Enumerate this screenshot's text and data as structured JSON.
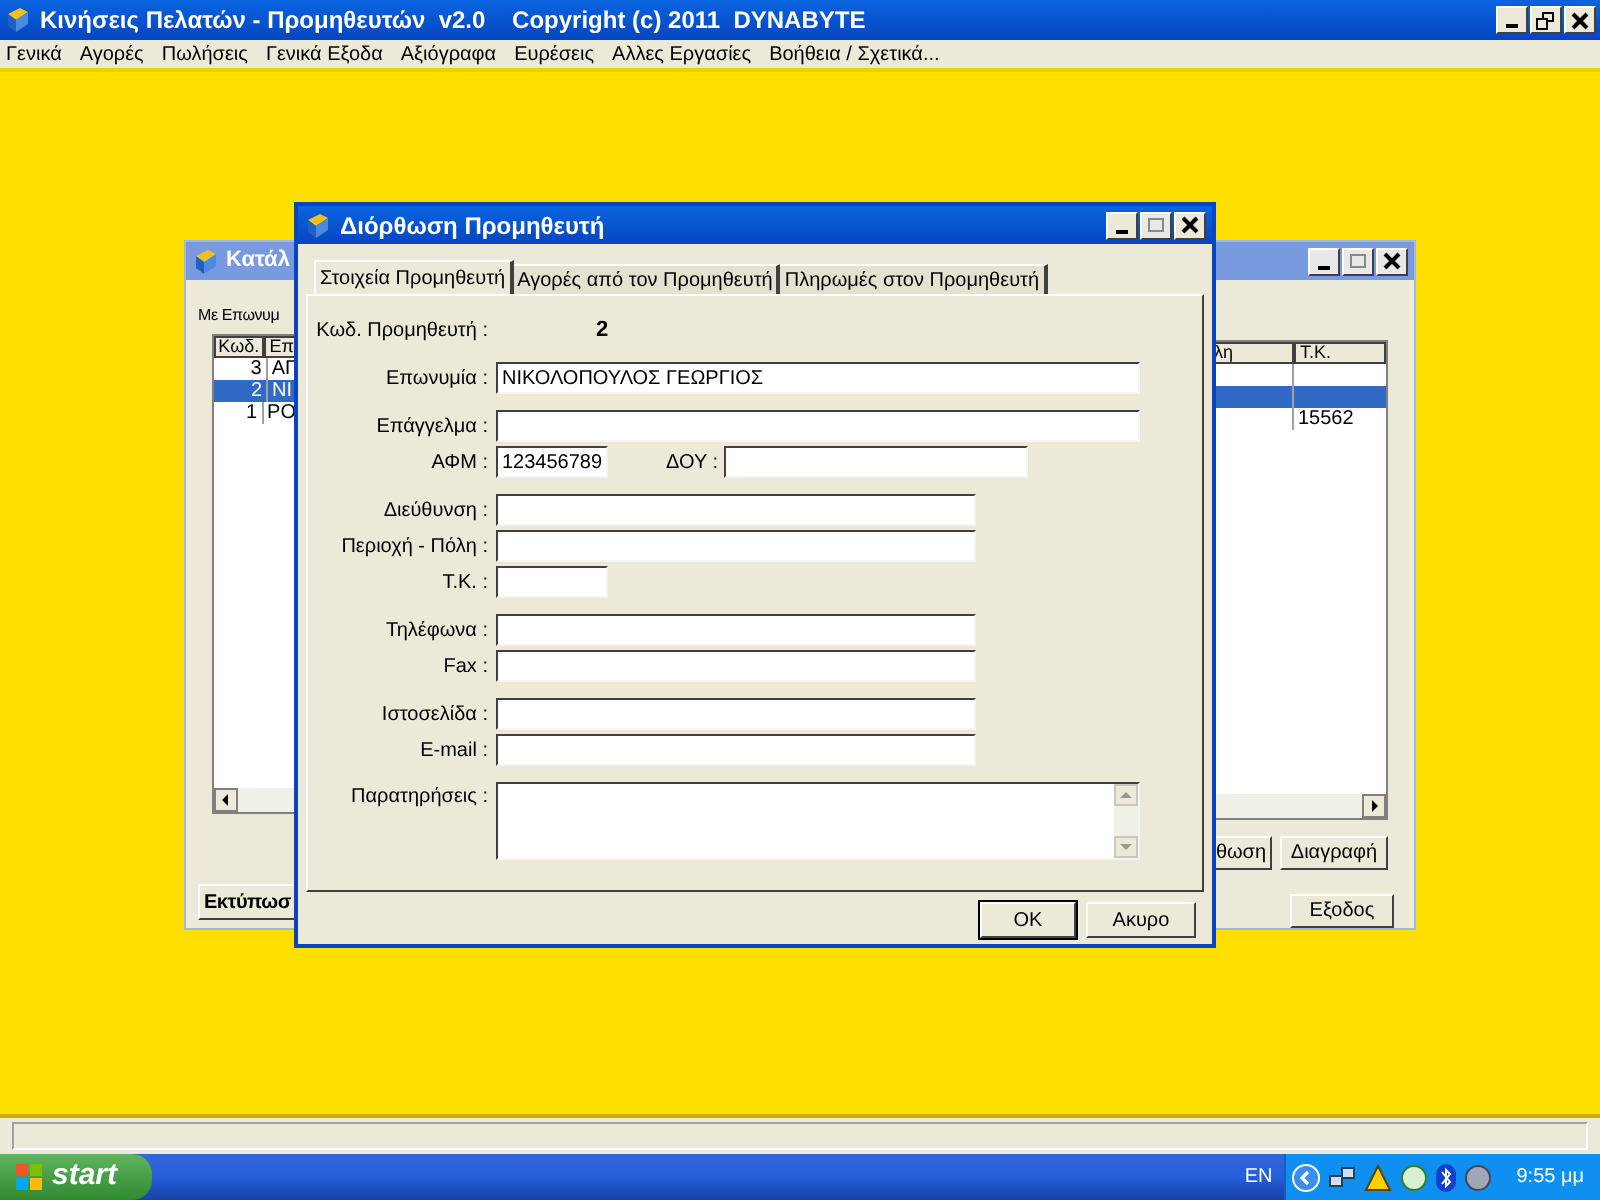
{
  "app": {
    "title": "Κινήσεις Πελατών - Προμηθευτών  v2.0    Copyright (c) 2011  DYNABYTE",
    "menu": [
      "Γενικά",
      "Αγορές",
      "Πωλήσεις",
      "Γενικά Εξοδα",
      "Αξιόγραφα",
      "Ευρέσεις",
      "Αλλες Εργασίες",
      "Βοήθεια / Σχετικά..."
    ]
  },
  "back_window": {
    "title": "Κατάλ",
    "filter_label": "Με Επωνυμ",
    "columns_left": [
      "Κωδ.",
      "Επ"
    ],
    "columns_right": [
      "λη",
      "Τ.Κ."
    ],
    "rows": [
      {
        "code": "3",
        "name": "ΑΓ",
        "selected": false
      },
      {
        "code": "2",
        "name": "ΝΙ",
        "selected": true
      },
      {
        "code": "1",
        "name": "ΡΟ",
        "tk": "15562",
        "selected": false
      }
    ],
    "buttons": [
      "θωση",
      "Διαγραφή"
    ],
    "print_button": "Εκτύπωσ",
    "exit_button": "Εξοδος"
  },
  "dialog": {
    "title": "Διόρθωση Προμηθευτή",
    "tabs": [
      {
        "label": "Στοιχεία Προμηθευτή",
        "selected": true
      },
      {
        "label": "Αγορές από τον Προμηθευτή",
        "selected": false
      },
      {
        "label": "Πληρωμές στον Προμηθευτή",
        "selected": false
      }
    ],
    "groups": [
      [
        {
          "kind": "value",
          "label": "Κωδ. Προμηθευτή :",
          "value": "2"
        }
      ],
      [
        {
          "kind": "input",
          "fields": [
            {
              "label": "Επωνυμία :",
              "value": "ΝΙΚΟΛΟΠΟΥΛΟΣ ΓΕΩΡΓΙΟΣ"
            }
          ]
        }
      ],
      [
        {
          "kind": "input",
          "fields": [
            {
              "label": "Επάγγελμα :"
            }
          ]
        },
        {
          "kind": "input",
          "fields": [
            {
              "label": "ΑΦΜ :",
              "value": "123456789"
            },
            {
              "label": "ΔΟΥ :"
            }
          ]
        }
      ],
      [
        {
          "kind": "input",
          "fields": [
            {
              "label": "Διεύθυνση :"
            }
          ]
        },
        {
          "kind": "input",
          "fields": [
            {
              "label": "Περιοχή - Πόλη :"
            }
          ]
        },
        {
          "kind": "input",
          "fields": [
            {
              "label": "Τ.Κ. :"
            }
          ]
        }
      ],
      [
        {
          "kind": "input",
          "fields": [
            {
              "label": "Τηλέφωνα :"
            }
          ]
        },
        {
          "kind": "input",
          "fields": [
            {
              "label": "Fax :"
            }
          ]
        }
      ],
      [
        {
          "kind": "input",
          "fields": [
            {
              "label": "Ιστοσελίδα :"
            }
          ]
        },
        {
          "kind": "input",
          "fields": [
            {
              "label": "E-mail :"
            }
          ]
        }
      ],
      [
        {
          "kind": "memo",
          "label": "Παρατηρήσεις :"
        }
      ]
    ],
    "buttons": [
      "OK",
      "Ακυρο"
    ]
  },
  "taskbar": {
    "start": "start",
    "language": "EN",
    "clock": "9:55 μμ"
  }
}
